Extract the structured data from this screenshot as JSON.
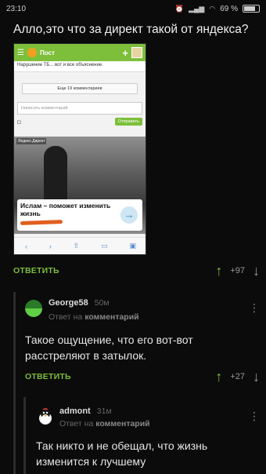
{
  "status_bar": {
    "time": "23:10",
    "battery": "69 %"
  },
  "post": {
    "title": "Алло,это что за директ такой от яндекса?",
    "image": {
      "tab_title": "Пост",
      "row_text": "Нарушение ТБ... вот и все объяснение.",
      "more_comments": "Еще 19 комментариев",
      "comment_placeholder": "Написать комментарий",
      "send_button": "Отправить",
      "ad_label": "Яндекс.Директ",
      "ad_text": "Ислам – поможет изменить жизнь"
    },
    "reply_label": "ОТВЕТИТЬ",
    "score": "+97"
  },
  "comments": [
    {
      "username": "George58",
      "time": "50м",
      "reply_prefix": "Ответ на",
      "reply_target": "комментарий",
      "text": "Такое ощущение, что его вот-вот расстреляют в затылок.",
      "reply_label": "ОТВЕТИТЬ",
      "score": "+27"
    },
    {
      "username": "admont",
      "time": "31м",
      "reply_prefix": "Ответ на",
      "reply_target": "комментарий",
      "text": "Так никто и не обещал, что жизнь изменится к лучшему"
    }
  ],
  "colors": {
    "accent": "#7cbd3a",
    "background": "#0b0b0b"
  }
}
